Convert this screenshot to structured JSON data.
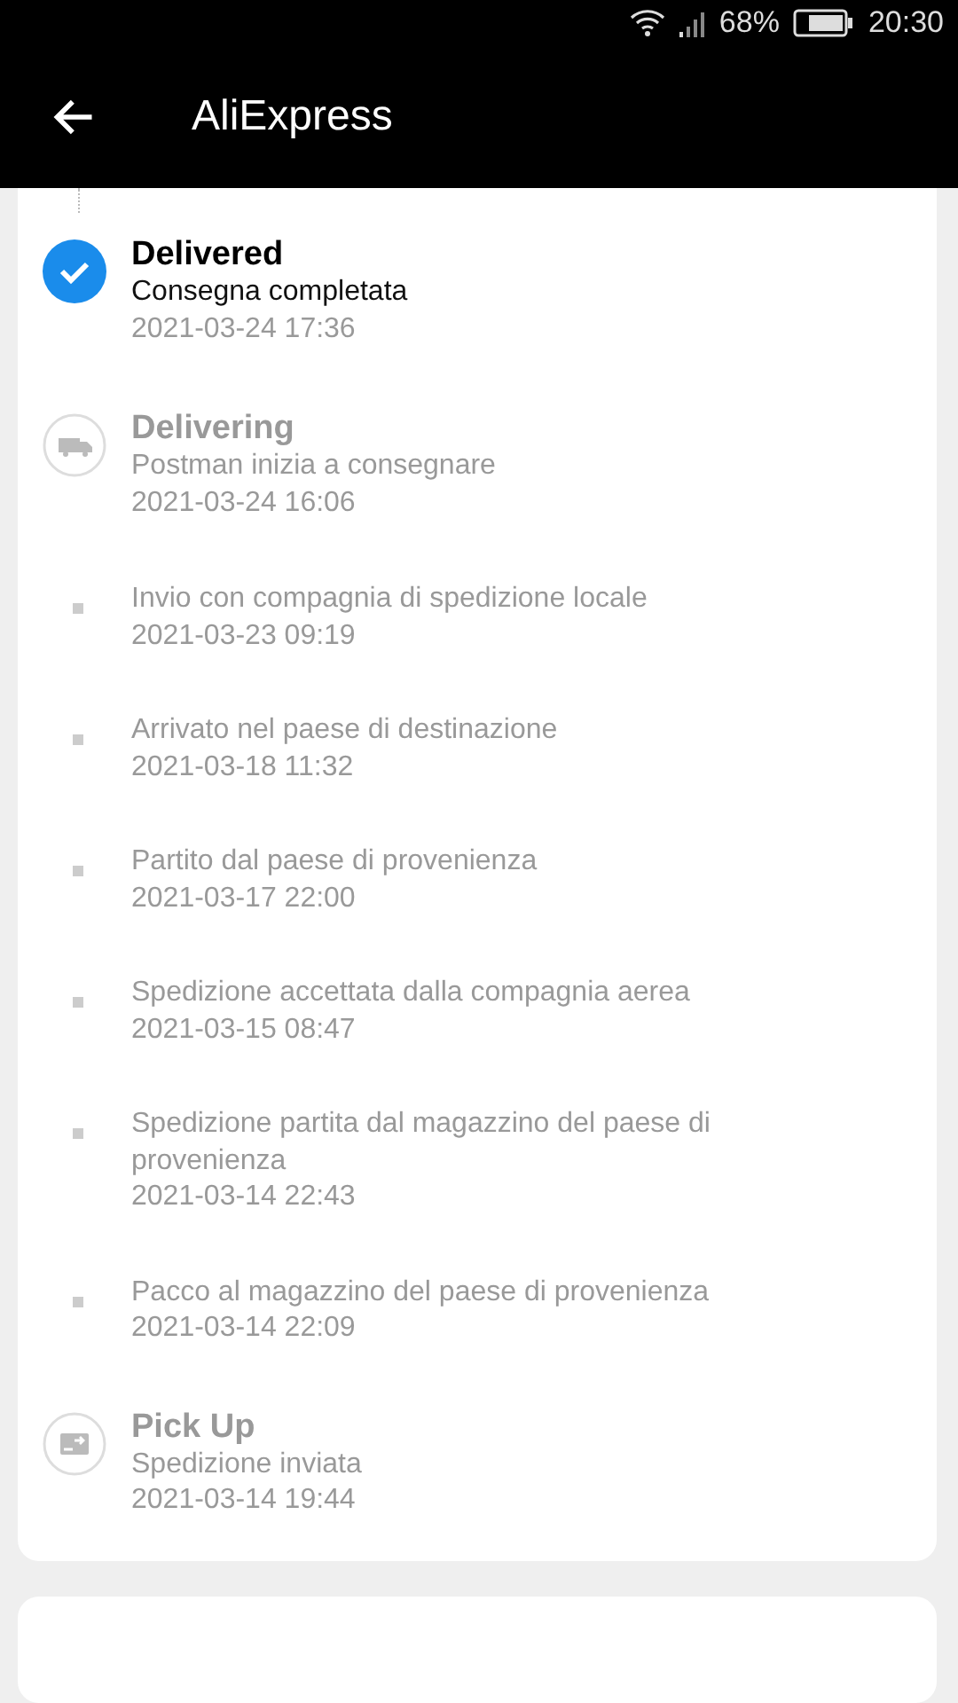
{
  "status_bar": {
    "battery_text": "68%",
    "time": "20:30"
  },
  "header": {
    "title": "AliExpress"
  },
  "events": [
    {
      "kind": "delivered",
      "current": true,
      "title": "Delivered",
      "text": "Consegna completata",
      "date": "2021-03-24 17:36"
    },
    {
      "kind": "delivering",
      "current": false,
      "title": "Delivering",
      "text": "Postman inizia a consegnare",
      "date": "2021-03-24 16:06"
    },
    {
      "kind": "step",
      "current": false,
      "text": "Invio con compagnia di spedizione locale",
      "date": "2021-03-23 09:19"
    },
    {
      "kind": "step",
      "current": false,
      "text": "Arrivato nel paese di destinazione",
      "date": "2021-03-18 11:32"
    },
    {
      "kind": "step",
      "current": false,
      "text": "Partito dal paese di provenienza",
      "date": "2021-03-17 22:00"
    },
    {
      "kind": "step",
      "current": false,
      "text": "Spedizione accettata dalla compagnia aerea",
      "date": "2021-03-15 08:47"
    },
    {
      "kind": "step",
      "current": false,
      "text": "Spedizione partita dal magazzino del paese di provenienza",
      "date": "2021-03-14 22:43"
    },
    {
      "kind": "step",
      "current": false,
      "text": "Pacco al magazzino del paese di provenienza",
      "date": "2021-03-14 22:09"
    },
    {
      "kind": "pickup",
      "current": false,
      "title": "Pick Up",
      "text": "Spedizione inviata",
      "date": "2021-03-14 19:44"
    }
  ]
}
